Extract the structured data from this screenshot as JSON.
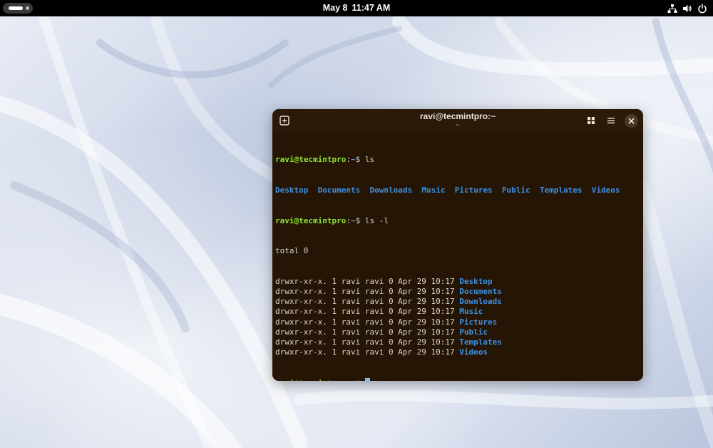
{
  "topbar": {
    "date": "May 8",
    "time": "11:47 AM",
    "icons": [
      "activities-indicator",
      "network-icon",
      "volume-icon",
      "power-icon"
    ]
  },
  "window": {
    "title": "ravi@tecmintpro:~",
    "subtitle": "~",
    "header_icons": [
      "new-tab-icon",
      "tab-overview-icon",
      "hamburger-menu-icon",
      "close-icon"
    ]
  },
  "terminal": {
    "prompt_user": "ravi@tecmintpro",
    "prompt_colon": ":",
    "prompt_path": "~",
    "prompt_symbol": "$ ",
    "cmd1": "ls",
    "ls_entries": [
      "Desktop",
      "Documents",
      "Downloads",
      "Music",
      "Pictures",
      "Public",
      "Templates",
      "Videos"
    ],
    "cmd2": "ls -l",
    "total": "total 0",
    "long_rows": [
      {
        "meta": "drwxr-xr-x. 1 ravi ravi 0 Apr 29 10:17 ",
        "name": "Desktop"
      },
      {
        "meta": "drwxr-xr-x. 1 ravi ravi 0 Apr 29 10:17 ",
        "name": "Documents"
      },
      {
        "meta": "drwxr-xr-x. 1 ravi ravi 0 Apr 29 10:17 ",
        "name": "Downloads"
      },
      {
        "meta": "drwxr-xr-x. 1 ravi ravi 0 Apr 29 10:17 ",
        "name": "Music"
      },
      {
        "meta": "drwxr-xr-x. 1 ravi ravi 0 Apr 29 10:17 ",
        "name": "Pictures"
      },
      {
        "meta": "drwxr-xr-x. 1 ravi ravi 0 Apr 29 10:17 ",
        "name": "Public"
      },
      {
        "meta": "drwxr-xr-x. 1 ravi ravi 0 Apr 29 10:17 ",
        "name": "Templates"
      },
      {
        "meta": "drwxr-xr-x. 1 ravi ravi 0 Apr 29 10:17 ",
        "name": "Videos"
      }
    ]
  },
  "colors": {
    "terminal_bg": "#251505",
    "prompt_green": "#8ae234",
    "directory_blue": "#3c8fe0",
    "text": "#d6d2cc",
    "topbar_bg": "#000000"
  }
}
